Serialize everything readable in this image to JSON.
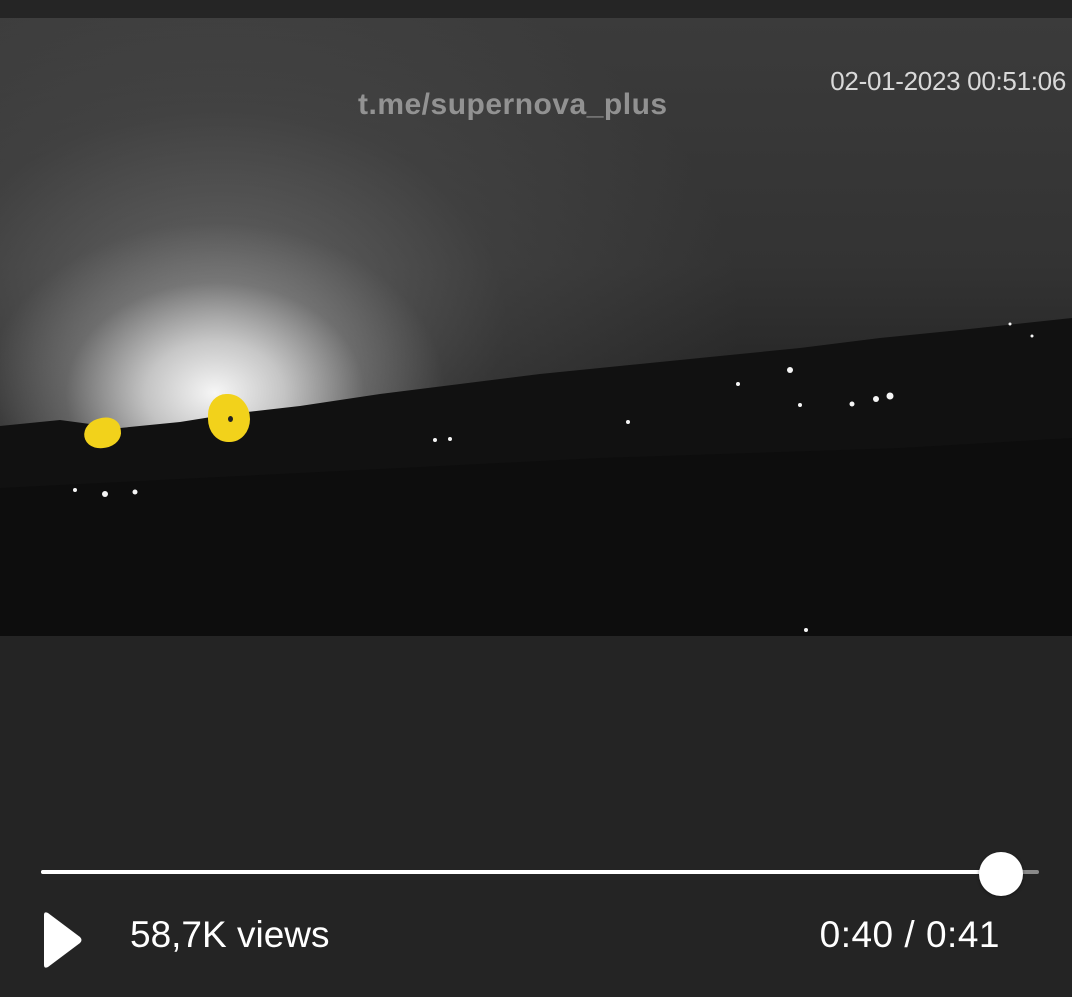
{
  "video": {
    "watermark": "t.me/supernova_plus",
    "timestamp": "02-01-2023 00:51:06",
    "annotation_color": "#f2d21b"
  },
  "player": {
    "play_icon": "play-icon",
    "views_label": "58,7K views",
    "current_time": "0:40",
    "duration": "0:41",
    "time_display": "0:40 / 0:41",
    "progress_fraction": 0.962,
    "progress_color": "#ffffff",
    "track_color": "#8a8a8a"
  }
}
